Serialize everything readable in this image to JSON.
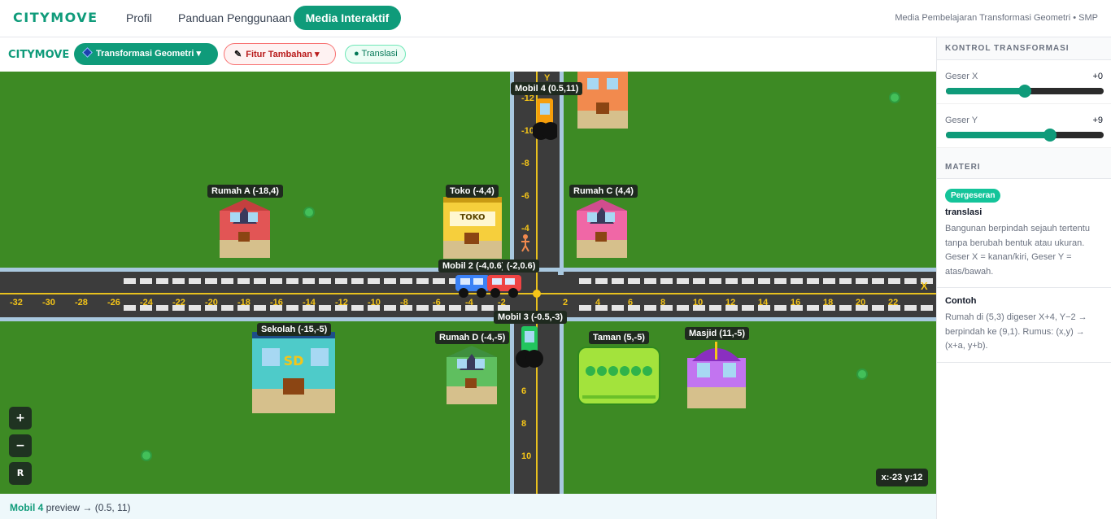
{
  "nav": {
    "brand": "CITYMOVE",
    "links": [
      "Profil",
      "Panduan Penggunaan"
    ],
    "active": "Media Interaktif",
    "subtitle": "Media Pembelajaran Transformasi Geometri • SMP"
  },
  "toolbar": {
    "brand": "CITYMOVE",
    "geo_label": "Transformasi Geometri ▾",
    "fitur_label": "Fitur Tambahan ▾",
    "mode_label": "● Translasi"
  },
  "map": {
    "axis_x_label": "X",
    "axis_y_label": "Y",
    "x_ticks": [
      "-32",
      "-30",
      "-28",
      "-26",
      "-24",
      "-22",
      "-20",
      "-18",
      "-16",
      "-14",
      "-12",
      "-10",
      "-8",
      "-6",
      "-4",
      "-2",
      "2",
      "4",
      "6",
      "8",
      "10",
      "12",
      "14",
      "16",
      "18",
      "20",
      "22"
    ],
    "y_ticks_up": [
      "-12",
      "-10",
      "-8",
      "-6",
      "-4"
    ],
    "y_ticks_down": [
      "6",
      "8",
      "10"
    ],
    "labels": {
      "mobil4": "Mobil 4 (0.5,11)",
      "rumah_a": "Rumah A (-18,4)",
      "toko": "Toko (-4,4)",
      "rumah_c": "Rumah C (4,4)",
      "mobil2": "Mobil 2 (-4,0.6)",
      "mobil1": "(-2,0.6)",
      "mobil3": "Mobil 3 (-0.5,-3)",
      "sekolah": "Sekolah (-15,-5)",
      "rumah_d": "Rumah D (-4,-5)",
      "taman": "Taman (5,-5)",
      "masjid": "Masjid (11,-5)"
    },
    "toko_sign": "TOKO",
    "sekolah_sign": "SD",
    "zoom_in": "+",
    "zoom_out": "−",
    "reset": "R",
    "coord_readout": "x:-23 y:12"
  },
  "status": {
    "object": "Mobil 4",
    "text": " preview → (0.5, 11)"
  },
  "side": {
    "kontrol_title": "KONTROL TRANSFORMASI",
    "geser_x_label": "Geser X",
    "geser_x_value": "+0",
    "geser_x_fraction": 0.5,
    "geser_y_label": "Geser Y",
    "geser_y_value": "+9",
    "geser_y_fraction": 0.66,
    "materi_title": "MATERI",
    "badge": "Pergeseran",
    "topic": "translasi",
    "topic_desc": "Bangunan berpindah sejauh tertentu tanpa berubah bentuk atau ukuran. Geser X = kanan/kiri, Geser Y = atas/bawah.",
    "contoh_title": "Contoh",
    "contoh_desc": "Rumah di (5,3) digeser X+4, Y−2 → berpindah ke (9,1). Rumus: (x,y) → (x+a, y+b)."
  },
  "colors": {
    "accent": "#0f9b7a",
    "grass": "#3d8a24",
    "road": "#3c3c3c"
  }
}
